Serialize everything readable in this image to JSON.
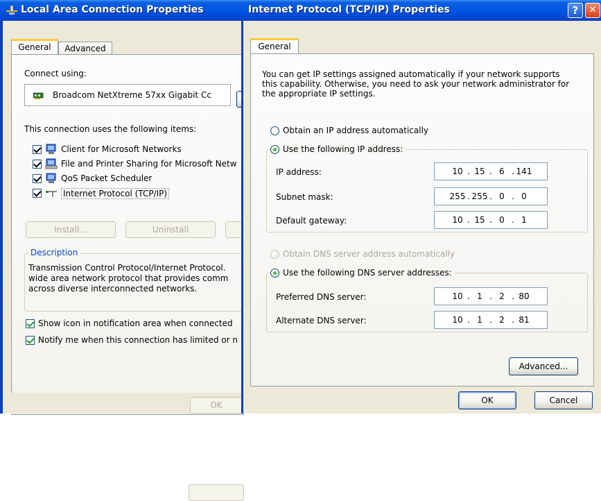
{
  "left_window": {
    "title": "Local Area Connection Properties",
    "tabs": [
      {
        "label": "General"
      },
      {
        "label": "Advanced"
      }
    ],
    "connect_using_label": "Connect using:",
    "adapter_name": "Broadcom NetXtreme 57xx Gigabit Cc",
    "items_label": "This connection uses the following items:",
    "items": [
      {
        "label": "Client for Microsoft Networks",
        "checked": true,
        "icon": "network-client-icon"
      },
      {
        "label": "File and Printer Sharing for Microsoft Netw",
        "checked": true,
        "icon": "file-sharing-icon"
      },
      {
        "label": "QoS Packet Scheduler",
        "checked": true,
        "icon": "qos-scheduler-icon"
      },
      {
        "label": "Internet Protocol (TCP/IP)",
        "checked": true,
        "icon": "protocol-icon"
      }
    ],
    "install_label": "Install...",
    "uninstall_label": "Uninstall",
    "description_label": "Description",
    "description_lines": [
      "Transmission Control Protocol/Internet Protocol.",
      "wide area network protocol that provides comm",
      "across diverse interconnected networks."
    ],
    "show_icon_label": "Show icon in notification area when connected",
    "notify_label": "Notify me when this connection has limited or n",
    "ok_label": "OK"
  },
  "right_window": {
    "title": "Internet Protocol (TCP/IP) Properties",
    "help_label": "?",
    "close_label": "✕",
    "tab_label": "General",
    "intro_lines": [
      "You can get IP settings assigned automatically if your network supports",
      "this capability. Otherwise, you need to ask your network administrator for",
      "the appropriate IP settings."
    ],
    "obtain_ip_label": "Obtain an IP address automatically",
    "use_ip_label": "Use the following IP address:",
    "ip_address_label": "IP address:",
    "ip_address": [
      "10",
      "15",
      "6",
      "141"
    ],
    "subnet_label": "Subnet mask:",
    "subnet_mask": [
      "255",
      "255",
      "0",
      "0"
    ],
    "gateway_label": "Default gateway:",
    "gateway": [
      "10",
      "15",
      "0",
      "1"
    ],
    "obtain_dns_label": "Obtain DNS server address automatically",
    "use_dns_label": "Use the following DNS server addresses:",
    "preferred_dns_label": "Preferred DNS server:",
    "preferred_dns": [
      "10",
      "1",
      "2",
      "80"
    ],
    "alternate_dns_label": "Alternate DNS server:",
    "alternate_dns": [
      "10",
      "1",
      "2",
      "81"
    ],
    "advanced_label": "Advanced...",
    "ok_label": "OK",
    "cancel_label": "Cancel"
  },
  "colors": {
    "title_blue": "#0054e3",
    "dialog_face": "#ece9d8",
    "close_red": "#e0431b",
    "tab_highlight": "#ffc83c"
  }
}
